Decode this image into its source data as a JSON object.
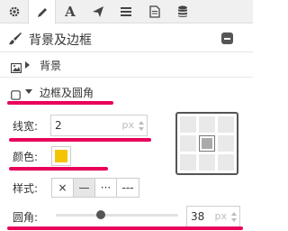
{
  "toolbar": {
    "tabs": [
      {
        "icon": "gear-icon",
        "active": false
      },
      {
        "icon": "pencil-icon",
        "active": true
      },
      {
        "icon": "text-icon",
        "label": "A",
        "active": false
      },
      {
        "icon": "paper-plane-icon",
        "active": false
      },
      {
        "icon": "menu-icon",
        "active": false
      },
      {
        "icon": "document-icon",
        "active": false
      },
      {
        "icon": "database-icon",
        "active": false
      }
    ]
  },
  "panel": {
    "title": "背景及边框",
    "icon": "brush-icon"
  },
  "sections": {
    "background": {
      "label": "背景",
      "icon": "image-icon",
      "expanded": false
    },
    "border": {
      "label": "边框及圆角",
      "icon": "square-icon",
      "expanded": true
    }
  },
  "border": {
    "width_label": "线宽:",
    "width_value": "2",
    "width_unit": "px",
    "color_label": "颜色:",
    "color_value": "#f5c400",
    "style_label": "样式:",
    "styles": [
      "×",
      "—",
      "···",
      "---"
    ],
    "active_style": 1,
    "radius_label": "圆角:",
    "radius_value": "38",
    "radius_unit": "px",
    "radius_fraction": 0.37
  },
  "colors": {
    "highlight": "#e8005a",
    "accent_swatch": "#f5c400"
  }
}
